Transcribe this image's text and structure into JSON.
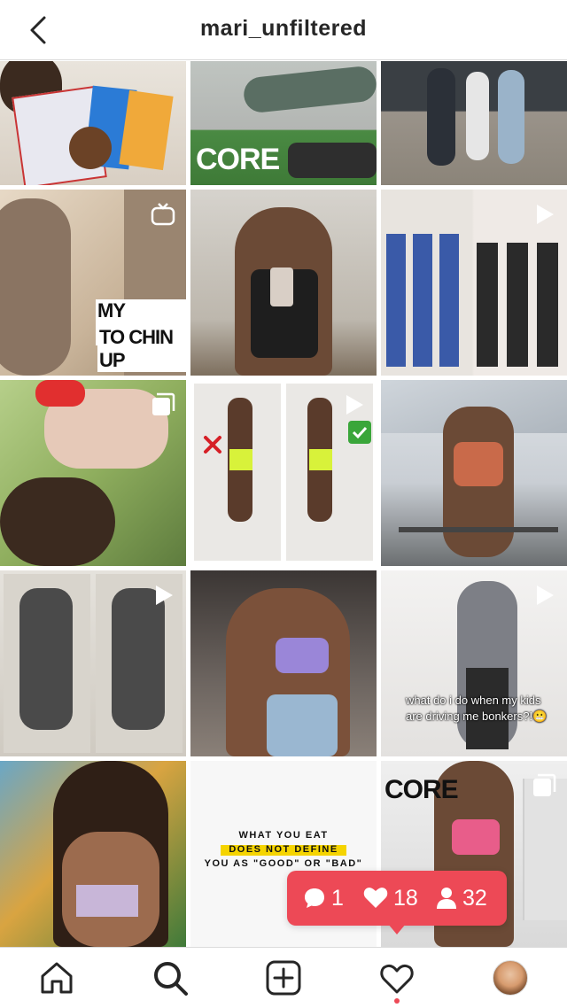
{
  "header": {
    "title": "mari_unfiltered"
  },
  "tiles": [
    {
      "caption": ""
    },
    {
      "caption": "CORE"
    },
    {
      "caption": ""
    },
    {
      "caption_line1": "MY JOURNE",
      "caption_line2": "TO CHIN UP"
    },
    {
      "caption": ""
    },
    {
      "caption": ""
    },
    {
      "caption": ""
    },
    {
      "caption": ""
    },
    {
      "caption": ""
    },
    {
      "caption": ""
    },
    {
      "caption": ""
    },
    {
      "caption_line1": "what do i do when my kids",
      "caption_line2": "are driving me bonkers?!😬"
    },
    {
      "caption": ""
    },
    {
      "caption_line1": "WHAT YOU EAT",
      "caption_line2": "DOES NOT DEFINE",
      "caption_line3": "YOU AS \"GOOD\" OR \"BAD\""
    },
    {
      "caption": "CORE"
    }
  ],
  "notification": {
    "comments": "1",
    "likes": "18",
    "followers": "32"
  },
  "colors": {
    "accent": "#ed4956",
    "yellow": "#f5d400"
  },
  "icons": [
    "back-icon",
    "home-icon",
    "search-icon",
    "new-post-icon",
    "activity-heart-icon",
    "profile-avatar",
    "igtv-icon",
    "video-icon",
    "carousel-icon"
  ]
}
